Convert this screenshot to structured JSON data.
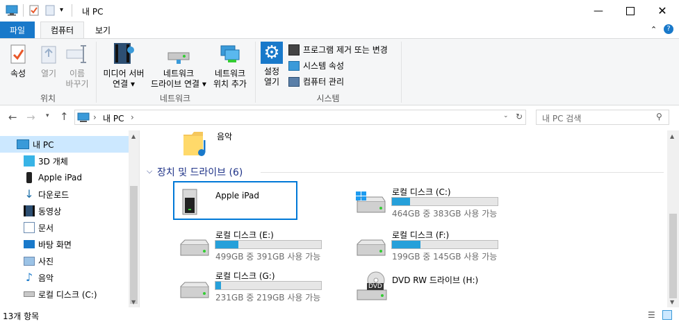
{
  "window": {
    "title": "내 PC"
  },
  "tabs": {
    "file": "파일",
    "computer": "컴퓨터",
    "view": "보기"
  },
  "ribbon": {
    "location": {
      "properties": "속성",
      "open": "열기",
      "rename_1": "이름",
      "rename_2": "바꾸기",
      "group": "위치"
    },
    "network": {
      "media_1": "미디어 서버",
      "media_2": "연결",
      "map_1": "네트워크",
      "map_2": "드라이브 연결",
      "add_1": "네트워크",
      "add_2": "위치 추가",
      "group": "네트워크"
    },
    "system": {
      "settings_1": "설정",
      "settings_2": "열기",
      "uninstall": "프로그램 제거 또는 변경",
      "sysprops": "시스템 속성",
      "manage": "컴퓨터 관리",
      "group": "시스템"
    }
  },
  "address": {
    "path_root": "내 PC",
    "search_placeholder": "내 PC 검색"
  },
  "nav": {
    "items": [
      {
        "label": "내 PC"
      },
      {
        "label": "3D 개체"
      },
      {
        "label": "Apple iPad"
      },
      {
        "label": "다운로드"
      },
      {
        "label": "동영상"
      },
      {
        "label": "문서"
      },
      {
        "label": "바탕 화면"
      },
      {
        "label": "사진"
      },
      {
        "label": "음악"
      },
      {
        "label": "로컬 디스크 (C:)"
      }
    ]
  },
  "content": {
    "music": "음악",
    "section_title": "장치 및 드라이브 (6)",
    "ipad": "Apple iPad",
    "drives": [
      {
        "name": "로컬 디스크 (C:)",
        "info": "464GB 중 383GB 사용 가능",
        "used_fraction": 0.17
      },
      {
        "name": "로컬 디스크 (E:)",
        "info": "499GB 중 391GB 사용 가능",
        "used_fraction": 0.22
      },
      {
        "name": "로컬 디스크 (F:)",
        "info": "199GB 중 145GB 사용 가능",
        "used_fraction": 0.27
      },
      {
        "name": "로컬 디스크 (G:)",
        "info": "231GB 중 219GB 사용 가능",
        "used_fraction": 0.05
      }
    ],
    "dvd": "DVD RW 드라이브 (H:)",
    "dvd_badge": "DVD"
  },
  "status": {
    "count": "13개 항목"
  },
  "colors": {
    "accent": "#1979ca",
    "selection": "#0078d7",
    "bar": "#26a0da"
  }
}
